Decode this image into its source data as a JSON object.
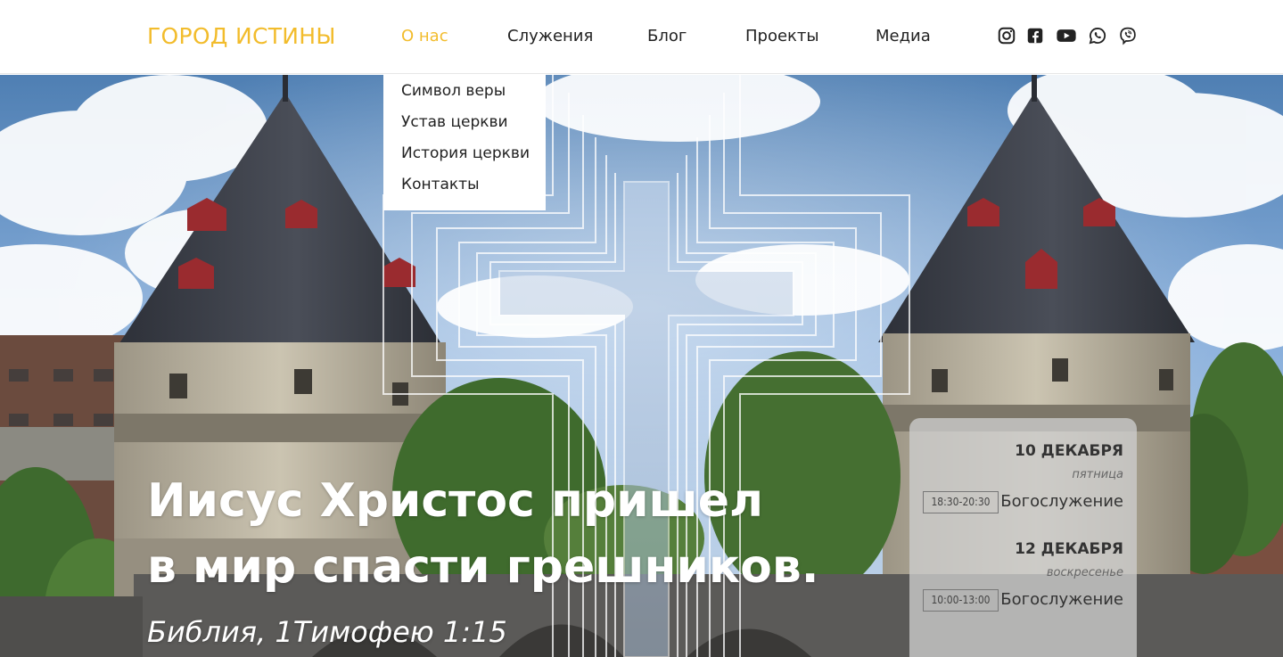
{
  "header": {
    "logo": "ГОРОД ИСТИНЫ",
    "nav": [
      {
        "label": "О нас",
        "active": true
      },
      {
        "label": "Служения",
        "active": false
      },
      {
        "label": "Блог",
        "active": false
      },
      {
        "label": "Проекты",
        "active": false
      },
      {
        "label": "Медиа",
        "active": false
      }
    ],
    "social": [
      "instagram-icon",
      "facebook-icon",
      "youtube-icon",
      "whatsapp-icon",
      "viber-icon"
    ],
    "accent_color": "#f2bc2c"
  },
  "dropdown": {
    "items": [
      "Символ веры",
      "Устав церкви",
      "История церкви",
      "Контакты"
    ]
  },
  "hero": {
    "headline_line1": "Иисус Христос пришел",
    "headline_line2": "в мир спасти грешников.",
    "quote": "Библия, 1Тимофею 1:15"
  },
  "schedule": {
    "events": [
      {
        "date": "10 ДЕКАБРЯ",
        "day": "пятница",
        "time": "18:30-20:30",
        "title": "Богослужение"
      },
      {
        "date": "12 ДЕКАБРЯ",
        "day": "воскресенье",
        "time": "10:00-13:00",
        "title": "Богослужение"
      }
    ]
  }
}
